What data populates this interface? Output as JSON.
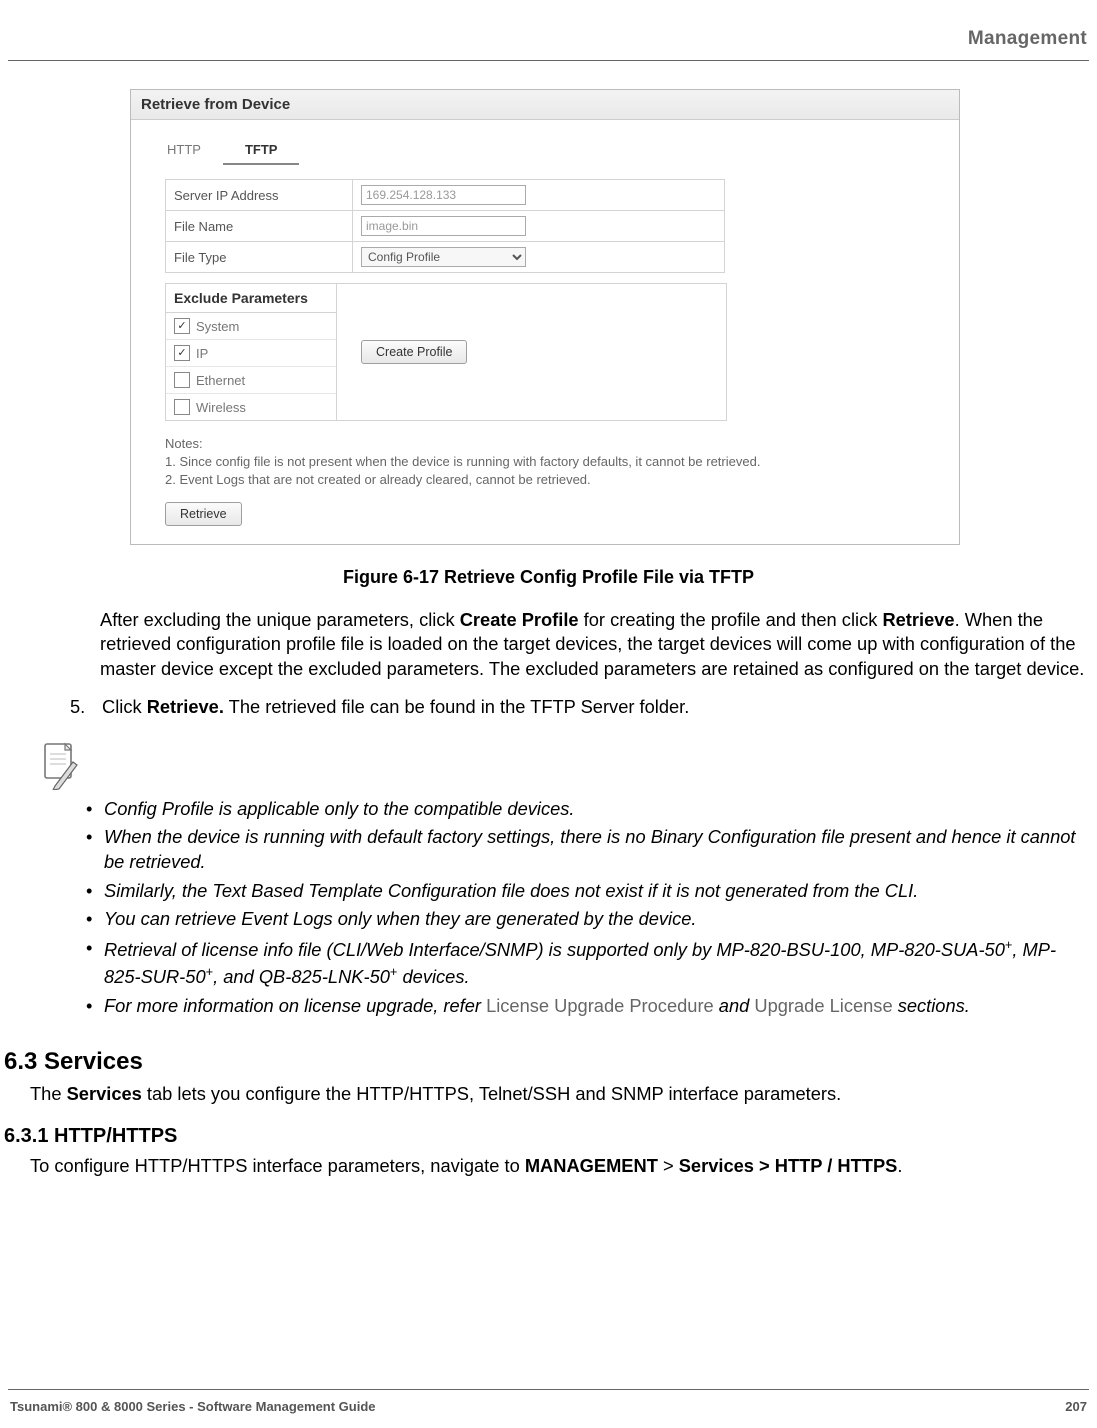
{
  "header": {
    "section": "Management"
  },
  "screenshot": {
    "title": "Retrieve from Device",
    "tabs": {
      "http": "HTTP",
      "tftp": "TFTP"
    },
    "fields": {
      "server_ip_label": "Server IP Address",
      "server_ip_value": "169.254.128.133",
      "file_name_label": "File Name",
      "file_name_value": "image.bin",
      "file_type_label": "File Type",
      "file_type_value": "Config Profile"
    },
    "exclude": {
      "title": "Exclude Parameters",
      "items": [
        {
          "label": "System",
          "checked": true
        },
        {
          "label": "IP",
          "checked": true
        },
        {
          "label": "Ethernet",
          "checked": false
        },
        {
          "label": "Wireless",
          "checked": false
        }
      ],
      "create_btn": "Create Profile"
    },
    "notes_label": "Notes:",
    "note1": "1. Since config file is not present when the device is running with factory defaults, it cannot be retrieved.",
    "note2": "2. Event Logs that are not created or already cleared, cannot be retrieved.",
    "retrieve_btn": "Retrieve"
  },
  "figure_caption": "Figure 6-17 Retrieve Config Profile File via TFTP",
  "paragraphs": {
    "after_fig_a": "After excluding the unique parameters, click ",
    "after_fig_b": "Create Profile",
    "after_fig_c": " for creating the profile and then click ",
    "after_fig_d": "Retrieve",
    "after_fig_e": ". When the retrieved configuration profile file is loaded on the target devices, the target devices will come up with configuration of the master device except the excluded parameters. The excluded parameters are retained as configured on the target device.",
    "step5_num": "5.",
    "step5_a": "Click ",
    "step5_b": "Retrieve.",
    "step5_c": " The retrieved file can be found in the TFTP Server folder."
  },
  "notes": {
    "n1": "Config Profile is applicable only to the compatible devices.",
    "n2": "When the device is running with default factory settings, there is no Binary Configuration file present and hence it cannot be retrieved.",
    "n3": "Similarly, the Text Based Template Configuration file does not exist if it is not generated from the CLI.",
    "n4": "You can retrieve Event Logs only when they are generated by the device.",
    "n5_a": "Retrieval of license info file (CLI/Web Interface/SNMP) is supported only by MP-820-BSU-100, MP-820-SUA-50",
    "n5_b": ", MP-825-SUR-50",
    "n5_c": ", and QB-825-LNK-50",
    "n5_d": " devices.",
    "n6_a": "For more information on license upgrade, refer ",
    "n6_link1": "License Upgrade Procedure",
    "n6_b": " and ",
    "n6_link2": "Upgrade License",
    "n6_c": " sections."
  },
  "sections": {
    "services_h": "6.3 Services",
    "services_p_a": "The ",
    "services_p_b": "Services",
    "services_p_c": " tab lets you configure the HTTP/HTTPS, Telnet/SSH and SNMP interface parameters.",
    "http_h": "6.3.1 HTTP/HTTPS",
    "http_p_a": "To configure HTTP/HTTPS interface parameters, navigate to ",
    "http_p_b": "MANAGEMENT",
    "http_p_c": " > ",
    "http_p_d": "Services > HTTP / HTTPS",
    "http_p_e": "."
  },
  "footer": {
    "left": "Tsunami® 800 & 8000 Series - Software Management Guide",
    "right": "207"
  }
}
